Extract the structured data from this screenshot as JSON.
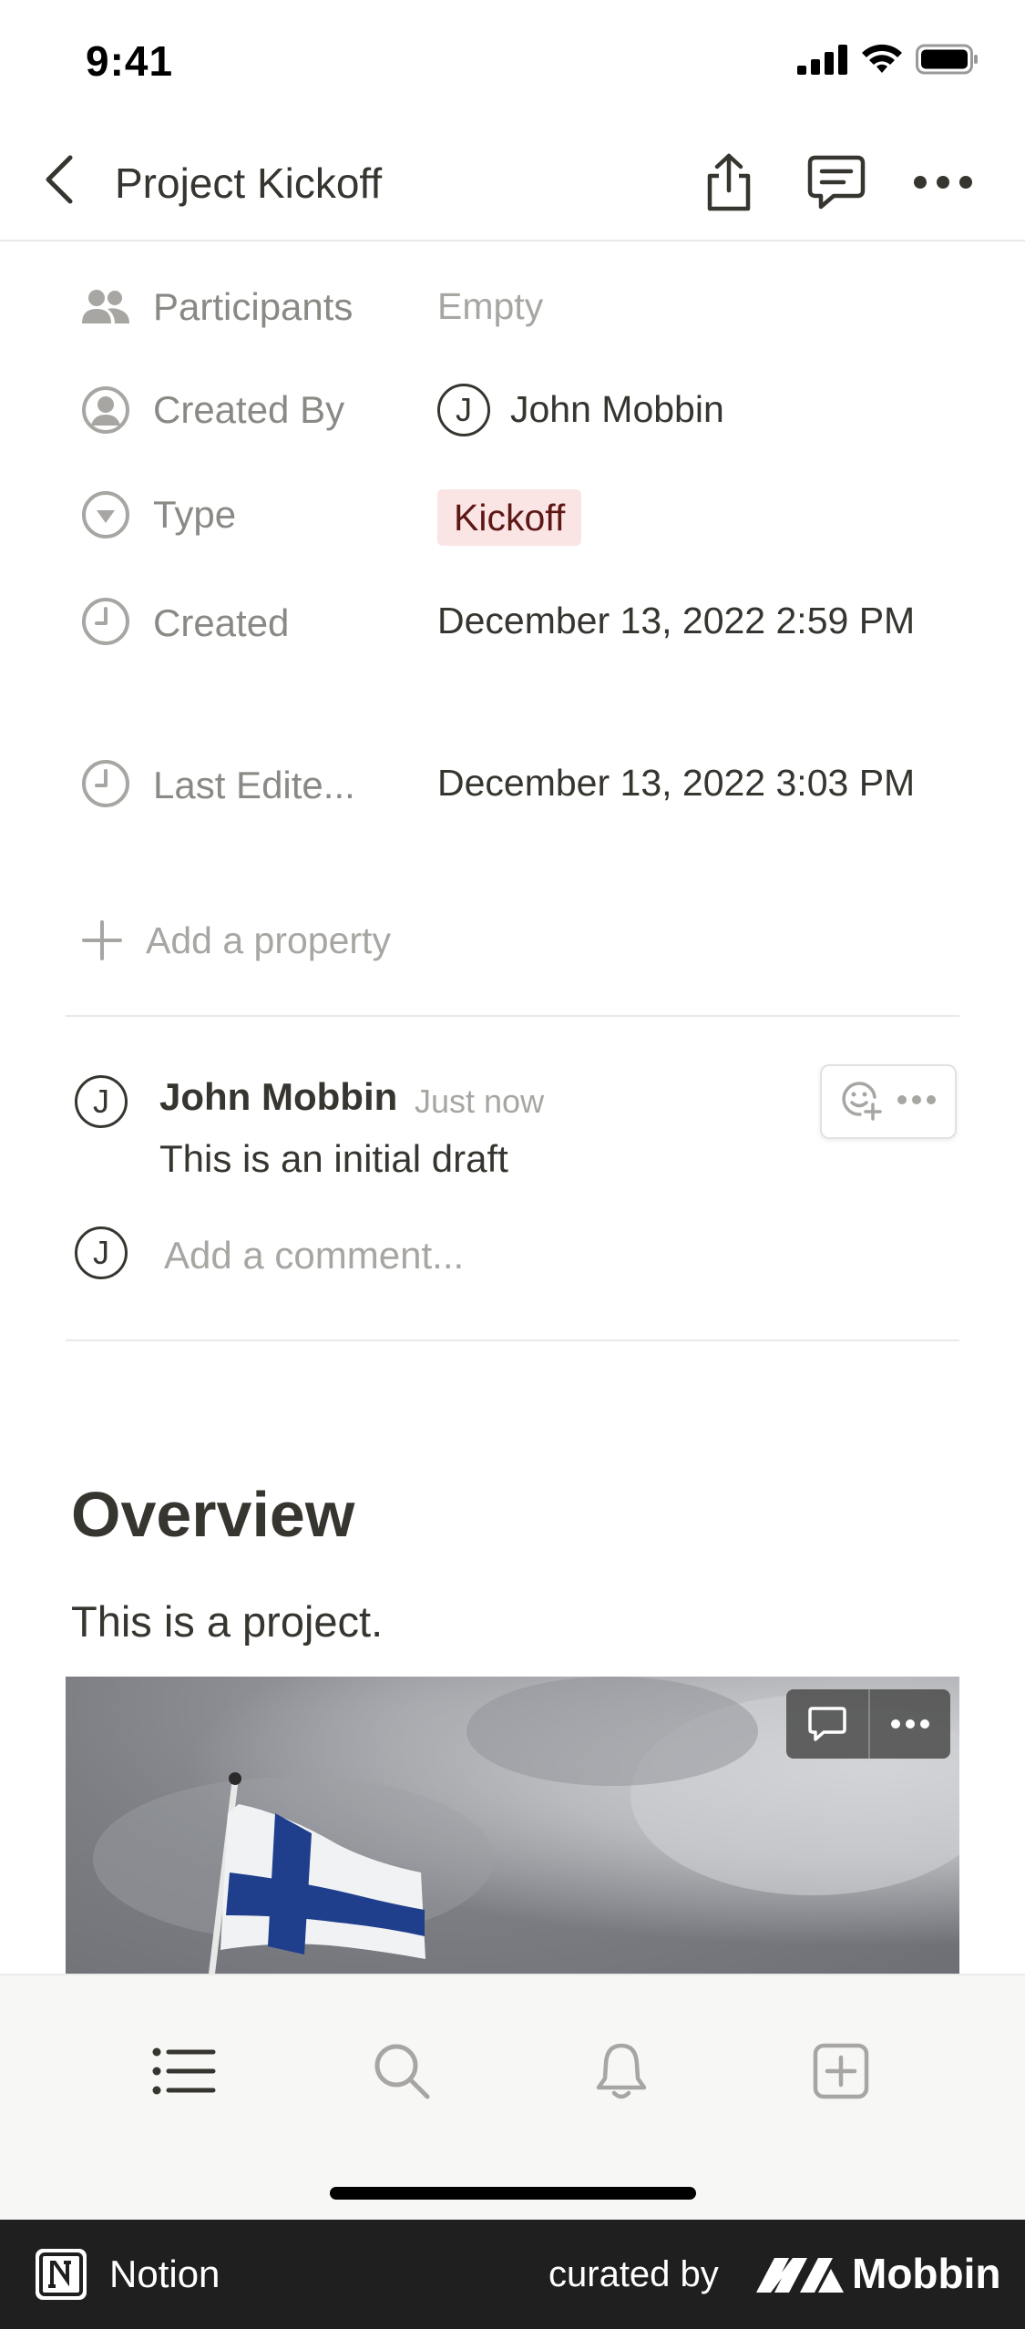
{
  "status_bar": {
    "time": "9:41"
  },
  "nav": {
    "title": "Project Kickoff"
  },
  "properties": [
    {
      "label": "Participants",
      "value": "Empty",
      "icon": "people-icon"
    },
    {
      "label": "Created By",
      "value": "John Mobbin",
      "avatar": "J",
      "icon": "person-circle-icon"
    },
    {
      "label": "Type",
      "value": "Kickoff",
      "icon": "select-circle-icon",
      "tag_color": "#fbe4e4"
    },
    {
      "label": "Created",
      "value": "December 13, 2022 2:59 PM",
      "icon": "clock-icon"
    },
    {
      "label": "Last Edite...",
      "value": "December 13, 2022 3:03 PM",
      "icon": "clock-icon"
    }
  ],
  "add_property": {
    "label": "Add a property"
  },
  "comment": {
    "avatar": "J",
    "author": "John Mobbin",
    "time": "Just now",
    "text": "This is an initial draft"
  },
  "add_comment": {
    "avatar": "J",
    "placeholder": "Add a comment..."
  },
  "content": {
    "heading": "Overview",
    "paragraph": "This is a project."
  },
  "tab_bar": {
    "items": [
      "list-icon",
      "search-icon",
      "bell-icon",
      "new-page-icon"
    ]
  },
  "footer": {
    "app_name": "Notion",
    "curated_by": "curated by",
    "brand": "Mobbin"
  }
}
